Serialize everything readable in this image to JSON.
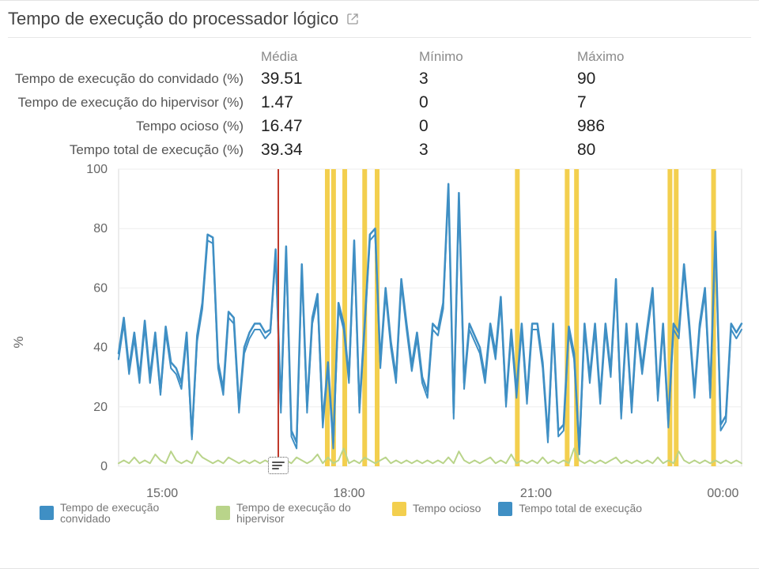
{
  "title": "Tempo de execução do processador lógico",
  "external_link_icon": "external-link",
  "stats": {
    "headers": [
      "Média",
      "Mínimo",
      "Máximo"
    ],
    "rows": [
      {
        "label": "Tempo de execução do convidado (%)",
        "avg": "39.51",
        "min": "3",
        "max": "90"
      },
      {
        "label": "Tempo de execução do hipervisor (%)",
        "avg": "1.47",
        "min": "0",
        "max": "7"
      },
      {
        "label": "Tempo ocioso (%)",
        "avg": "16.47",
        "min": "0",
        "max": "986"
      },
      {
        "label": "Tempo total de execução (%)",
        "avg": "39.34",
        "min": "3",
        "max": "80"
      }
    ]
  },
  "legend": {
    "items": [
      {
        "label": "Tempo de execução convidado",
        "color": "#3f8fc4"
      },
      {
        "label": "Tempo de execução do hipervisor",
        "color": "#b9d48a"
      },
      {
        "label": "Tempo ocioso",
        "color": "#f3cf4e"
      },
      {
        "label": "Tempo total de execução",
        "color": "#3f8fc4"
      }
    ]
  },
  "chart_data": {
    "type": "line",
    "ylabel": "%",
    "ylim": [
      0,
      100
    ],
    "yticks": [
      0,
      20,
      40,
      60,
      80,
      100
    ],
    "x_categories": [
      "15:00",
      "18:00",
      "21:00",
      "00:00"
    ],
    "x_category_positions": [
      0.07,
      0.37,
      0.67,
      0.97
    ],
    "event_marker": {
      "x": 0.256,
      "color": "#c0392b",
      "has_note": true
    },
    "idle_spikes_x": [
      0.335,
      0.345,
      0.363,
      0.395,
      0.415,
      0.64,
      0.72,
      0.735,
      0.885,
      0.895,
      0.955
    ],
    "series": [
      {
        "name": "Tempo de execução convidado",
        "color": "#3f8fc4",
        "width": 2.5,
        "values": [
          38,
          50,
          33,
          45,
          30,
          49,
          30,
          45,
          25,
          47,
          35,
          33,
          28,
          45,
          10,
          44,
          55,
          78,
          77,
          35,
          26,
          52,
          50,
          20,
          40,
          45,
          48,
          48,
          45,
          46,
          73,
          20,
          74,
          12,
          8,
          68,
          20,
          50,
          58,
          15,
          35,
          8,
          55,
          48,
          30,
          76,
          20,
          48,
          78,
          80,
          35,
          60,
          42,
          30,
          63,
          48,
          34,
          45,
          30,
          25,
          48,
          46,
          55,
          95,
          18,
          92,
          28,
          48,
          44,
          40,
          30,
          48,
          38,
          57,
          22,
          46,
          25,
          48,
          23,
          48,
          48,
          35,
          10,
          48,
          12,
          14,
          47,
          38,
          6,
          48,
          30,
          48,
          23,
          48,
          32,
          63,
          18,
          48,
          20,
          48,
          33,
          47,
          60,
          24,
          48,
          15,
          48,
          45,
          68,
          48,
          25,
          48,
          60,
          25,
          79,
          14,
          17,
          48,
          45,
          48
        ]
      },
      {
        "name": "Tempo total de execução",
        "color": "#3f8fc4",
        "width": 2,
        "values": [
          36,
          48,
          31,
          43,
          28,
          47,
          28,
          43,
          24,
          45,
          33,
          31,
          26,
          43,
          9,
          42,
          53,
          76,
          75,
          33,
          24,
          50,
          48,
          18,
          38,
          43,
          46,
          46,
          43,
          45,
          71,
          18,
          72,
          10,
          6,
          66,
          18,
          48,
          56,
          13,
          33,
          6,
          53,
          46,
          28,
          74,
          18,
          46,
          76,
          78,
          33,
          58,
          40,
          28,
          61,
          46,
          32,
          43,
          28,
          23,
          46,
          44,
          53,
          93,
          16,
          90,
          26,
          46,
          42,
          38,
          28,
          46,
          36,
          55,
          20,
          44,
          23,
          46,
          21,
          46,
          46,
          33,
          8,
          46,
          10,
          12,
          45,
          36,
          4,
          46,
          28,
          46,
          21,
          46,
          30,
          61,
          16,
          46,
          18,
          46,
          31,
          45,
          58,
          22,
          46,
          13,
          46,
          43,
          66,
          46,
          23,
          46,
          58,
          23,
          77,
          12,
          15,
          46,
          43,
          46
        ]
      },
      {
        "name": "Tempo de execução do hipervisor",
        "color": "#b9d48a",
        "width": 2,
        "values": [
          1,
          2,
          1,
          3,
          1,
          2,
          1,
          4,
          2,
          1,
          5,
          2,
          1,
          2,
          1,
          5,
          3,
          2,
          1,
          2,
          1,
          3,
          2,
          1,
          2,
          1,
          2,
          1,
          2,
          1,
          3,
          1,
          2,
          1,
          3,
          2,
          1,
          2,
          4,
          1,
          3,
          1,
          2,
          6,
          1,
          2,
          1,
          3,
          2,
          1,
          2,
          3,
          1,
          2,
          1,
          2,
          1,
          2,
          1,
          2,
          1,
          2,
          1,
          3,
          1,
          5,
          2,
          1,
          2,
          1,
          2,
          3,
          1,
          2,
          1,
          4,
          1,
          2,
          1,
          2,
          1,
          3,
          1,
          2,
          1,
          2,
          1,
          6,
          2,
          1,
          2,
          1,
          2,
          1,
          2,
          3,
          1,
          2,
          1,
          2,
          1,
          2,
          1,
          3,
          1,
          2,
          1,
          5,
          2,
          1,
          2,
          1,
          2,
          1,
          2,
          1,
          2,
          1,
          2,
          1
        ]
      }
    ]
  }
}
